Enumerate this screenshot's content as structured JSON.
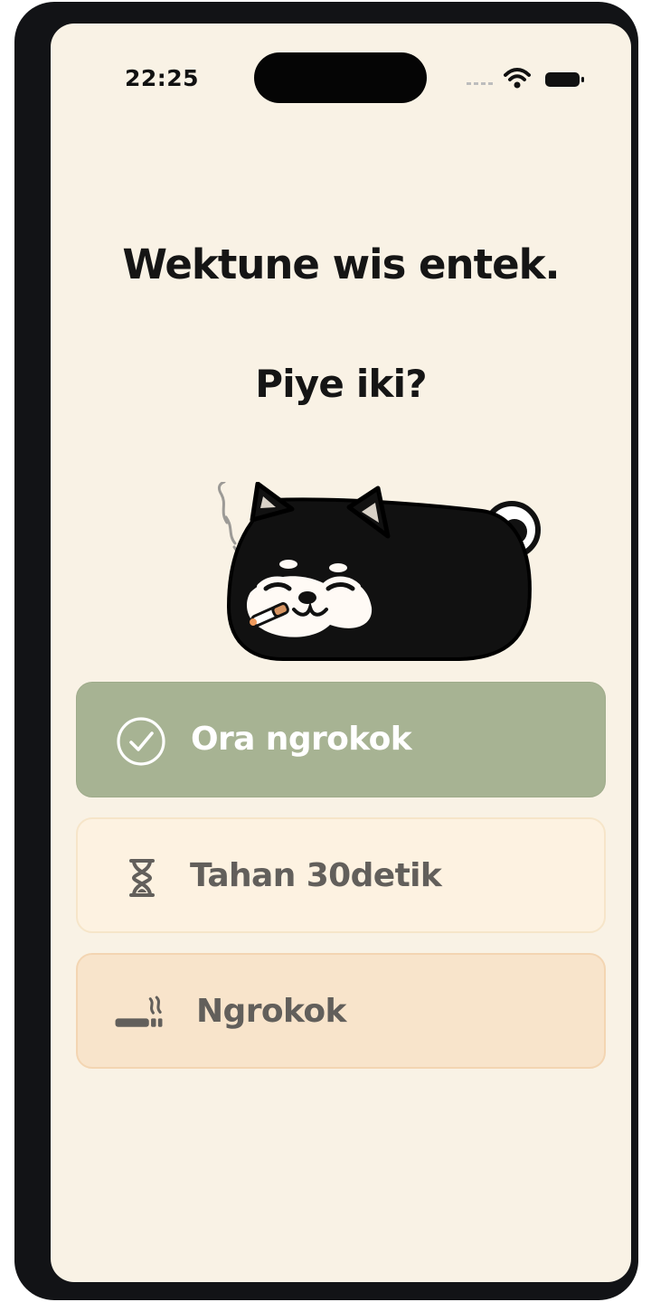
{
  "status_bar": {
    "time": "22:25"
  },
  "prompt": {
    "headline": "Wektune wis entek.",
    "subheadline": "Piye iki?"
  },
  "options": [
    {
      "label": "Ora ngrokok",
      "icon": "check-circle-icon",
      "background": "#a7b393"
    },
    {
      "label": "Tahan 30detik",
      "icon": "hourglass-icon",
      "background": "#fdf2e1"
    },
    {
      "label": "Ngrokok",
      "icon": "cigarette-icon",
      "background": "#f8e4cb"
    }
  ],
  "colors": {
    "screen_background": "#f9f2e5",
    "device_frame": "#121316",
    "text_primary": "#151515",
    "text_secondary": "#625f5b"
  }
}
